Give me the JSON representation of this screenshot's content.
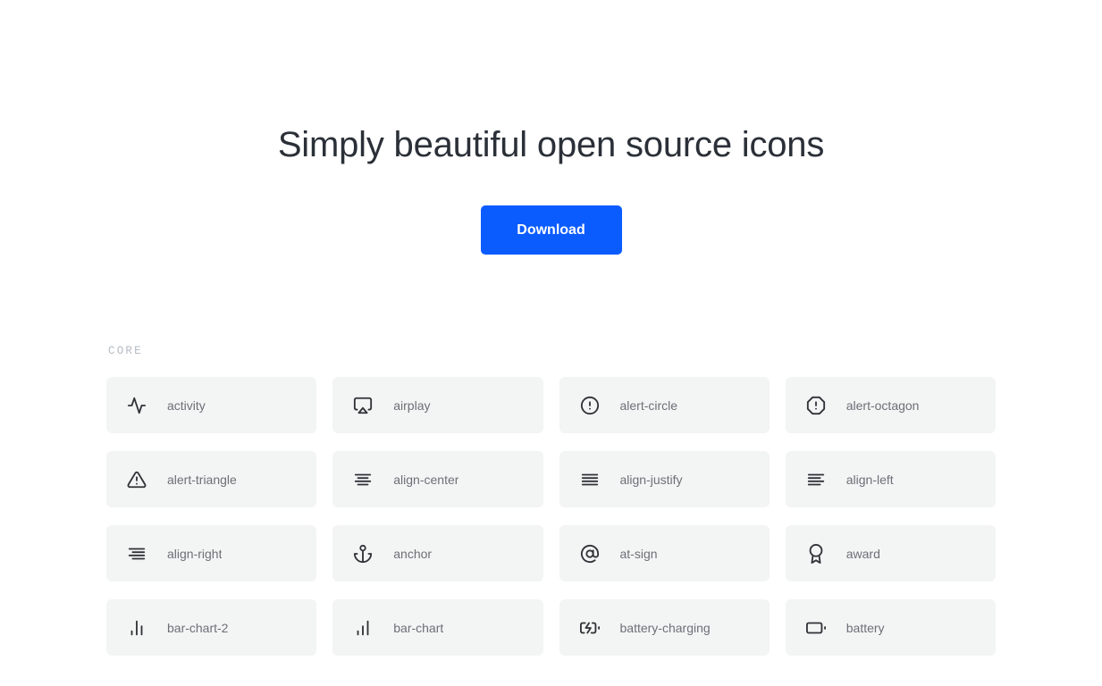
{
  "hero": {
    "title": "Simply beautiful open source icons",
    "download_label": "Download"
  },
  "section": {
    "label": "CORE"
  },
  "colors": {
    "accent": "#0b5cff",
    "card_background": "#f3f4f4",
    "icon": "#2f3337",
    "caption": "#6c7076",
    "section_label": "#b5bcc4",
    "heading": "#2b3038",
    "page_background": "#ffffff"
  },
  "icons": [
    {
      "name": "activity",
      "icon": "activity-icon"
    },
    {
      "name": "airplay",
      "icon": "airplay-icon"
    },
    {
      "name": "alert-circle",
      "icon": "alert-circle-icon"
    },
    {
      "name": "alert-octagon",
      "icon": "alert-octagon-icon"
    },
    {
      "name": "alert-triangle",
      "icon": "alert-triangle-icon"
    },
    {
      "name": "align-center",
      "icon": "align-center-icon"
    },
    {
      "name": "align-justify",
      "icon": "align-justify-icon"
    },
    {
      "name": "align-left",
      "icon": "align-left-icon"
    },
    {
      "name": "align-right",
      "icon": "align-right-icon"
    },
    {
      "name": "anchor",
      "icon": "anchor-icon"
    },
    {
      "name": "at-sign",
      "icon": "at-sign-icon"
    },
    {
      "name": "award",
      "icon": "award-icon"
    },
    {
      "name": "bar-chart-2",
      "icon": "bar-chart-2-icon"
    },
    {
      "name": "bar-chart",
      "icon": "bar-chart-icon"
    },
    {
      "name": "battery-charging",
      "icon": "battery-charging-icon"
    },
    {
      "name": "battery",
      "icon": "battery-icon"
    }
  ]
}
